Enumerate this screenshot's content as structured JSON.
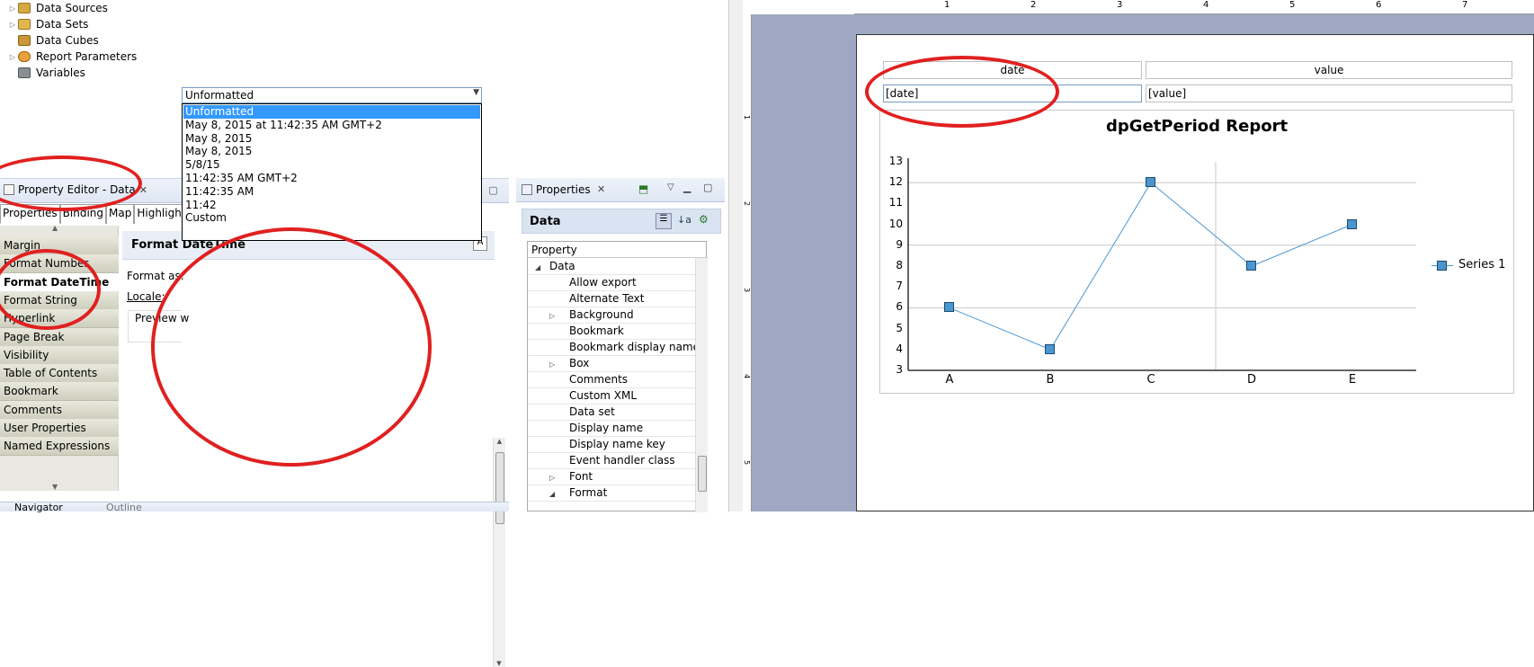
{
  "data_explorer": {
    "items": [
      {
        "label": "Data Sources",
        "icon": "data-source-icon",
        "expandable": true
      },
      {
        "label": "Data Sets",
        "icon": "data-set-icon",
        "expandable": true
      },
      {
        "label": "Data Cubes",
        "icon": "data-cube-icon",
        "expandable": false
      },
      {
        "label": "Report Parameters",
        "icon": "parameter-icon",
        "expandable": true
      },
      {
        "label": "Variables",
        "icon": "variable-icon",
        "expandable": false
      }
    ]
  },
  "property_editor": {
    "title": "Property Editor - Data",
    "tabs": [
      "Properties",
      "Binding",
      "Map",
      "Highlights"
    ],
    "nav_items": [
      "Margin",
      "Format Number",
      "Format DateTime",
      "Format String",
      "Hyperlink",
      "Page Break",
      "Visibility",
      "Table of Contents",
      "Bookmark",
      "Comments",
      "User Properties",
      "Named Expressions"
    ],
    "selected_nav": "Format DateTime",
    "section_title": "Format DateTime",
    "format_as_label": "Format as:",
    "format_as_value": "Unformatted",
    "locale_label": "Locale:",
    "preview_label": "Preview w",
    "dropdown_options": [
      "Unformatted",
      "May 8, 2015 at 11:42:35 AM GMT+2",
      "May 8, 2015",
      "May 8, 2015",
      "5/8/15",
      "11:42:35 AM GMT+2",
      "11:42:35 AM",
      "11:42",
      "Custom"
    ]
  },
  "bottom_tabs": [
    "Navigator",
    "Outline"
  ],
  "properties_view": {
    "title": "Properties",
    "header": "Data",
    "column": "Property",
    "rows": [
      {
        "label": "Data",
        "indent": 0,
        "twisty": "open"
      },
      {
        "label": "Allow export",
        "indent": 1,
        "twisty": ""
      },
      {
        "label": "Alternate Text",
        "indent": 1,
        "twisty": ""
      },
      {
        "label": "Background",
        "indent": 1,
        "twisty": "closed"
      },
      {
        "label": "Bookmark",
        "indent": 1,
        "twisty": ""
      },
      {
        "label": "Bookmark display name",
        "indent": 1,
        "twisty": ""
      },
      {
        "label": "Box",
        "indent": 1,
        "twisty": "closed"
      },
      {
        "label": "Comments",
        "indent": 1,
        "twisty": ""
      },
      {
        "label": "Custom XML",
        "indent": 1,
        "twisty": ""
      },
      {
        "label": "Data set",
        "indent": 1,
        "twisty": ""
      },
      {
        "label": "Display name",
        "indent": 1,
        "twisty": ""
      },
      {
        "label": "Display name key",
        "indent": 1,
        "twisty": ""
      },
      {
        "label": "Event handler class",
        "indent": 1,
        "twisty": ""
      },
      {
        "label": "Font",
        "indent": 1,
        "twisty": "closed"
      },
      {
        "label": "Format",
        "indent": 1,
        "twisty": "open"
      }
    ]
  },
  "ruler": {
    "top_labels": [
      "1",
      "2",
      "3",
      "4",
      "5",
      "6",
      "7"
    ],
    "left_labels": [
      "1",
      "2",
      "3",
      "4",
      "5"
    ]
  },
  "report": {
    "header_cells": [
      "date",
      "value"
    ],
    "detail_cells": [
      "[date]",
      "[value]"
    ]
  },
  "chart_data": {
    "type": "line",
    "title": "dpGetPeriod Report",
    "categories": [
      "A",
      "B",
      "C",
      "D",
      "E"
    ],
    "series": [
      {
        "name": "Series 1",
        "values": [
          6,
          4,
          12,
          8,
          10
        ]
      }
    ],
    "yticks": [
      3,
      4,
      5,
      6,
      7,
      8,
      9,
      10,
      11,
      12,
      13
    ],
    "ylim": [
      3,
      13
    ],
    "legend": "right",
    "color": "#4a96d1"
  },
  "colors": {
    "annotation": "#e02020",
    "selection": "#3399ff",
    "canvas": "#9ea8c2"
  }
}
